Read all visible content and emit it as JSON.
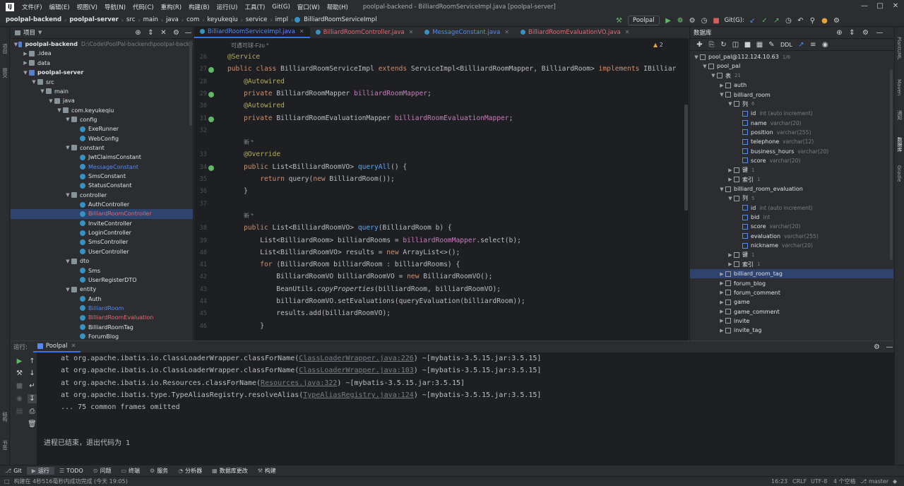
{
  "menubar": {
    "logo": "IJ",
    "items": [
      "文件(F)",
      "编辑(E)",
      "视图(V)",
      "导航(N)",
      "代码(C)",
      "重构(R)",
      "构建(B)",
      "运行(U)",
      "工具(T)",
      "Git(G)",
      "窗口(W)",
      "帮助(H)"
    ],
    "window_title": "poolpal-backend - BilliardRoomServiceImpl.java [poolpal-server]"
  },
  "navbar": {
    "breadcrumbs": [
      "poolpal-backend",
      "poolpal-server",
      "src",
      "main",
      "java",
      "com",
      "keyukeqiu",
      "service",
      "impl",
      "BilliardRoomServiceImpl"
    ],
    "run_config": "Poolpal",
    "git_label": "Git(G):"
  },
  "left_strip": {
    "labels": [
      "项目",
      "提交",
      "结构",
      "书签"
    ]
  },
  "right_strip": {
    "labels": [
      "PlantUML",
      "Maven",
      "通知",
      "数据库",
      "Gradle"
    ]
  },
  "project": {
    "title": "项目",
    "tree": [
      {
        "label": "poolpal-backend",
        "path": "D:\\Code\\PoolPal-backend\\poolpal-backe",
        "depth": 0,
        "open": true,
        "icon": "module",
        "bold": true
      },
      {
        "label": ".idea",
        "depth": 1,
        "open": false,
        "icon": "folder"
      },
      {
        "label": "data",
        "depth": 1,
        "open": false,
        "icon": "folder"
      },
      {
        "label": "poolpal-server",
        "depth": 1,
        "open": true,
        "icon": "module",
        "bold": true
      },
      {
        "label": "src",
        "depth": 2,
        "open": true,
        "icon": "folder"
      },
      {
        "label": "main",
        "depth": 3,
        "open": true,
        "icon": "folder"
      },
      {
        "label": "java",
        "depth": 4,
        "open": true,
        "icon": "folder"
      },
      {
        "label": "com.keyukeqiu",
        "depth": 5,
        "open": true,
        "icon": "folder"
      },
      {
        "label": "config",
        "depth": 6,
        "open": true,
        "icon": "folder"
      },
      {
        "label": "ExeRunner",
        "depth": 7,
        "icon": "class"
      },
      {
        "label": "WebConfig",
        "depth": 7,
        "icon": "class"
      },
      {
        "label": "constant",
        "depth": 6,
        "open": true,
        "icon": "folder"
      },
      {
        "label": "JwtClaimsConstant",
        "depth": 7,
        "icon": "class"
      },
      {
        "label": "MessageConstant",
        "depth": 7,
        "icon": "class",
        "color": "#548af7"
      },
      {
        "label": "SmsConstant",
        "depth": 7,
        "icon": "class"
      },
      {
        "label": "StatusConstant",
        "depth": 7,
        "icon": "class"
      },
      {
        "label": "controller",
        "depth": 6,
        "open": true,
        "icon": "folder"
      },
      {
        "label": "AuthController",
        "depth": 7,
        "icon": "class"
      },
      {
        "label": "BilliardRoomController",
        "depth": 7,
        "icon": "class",
        "color": "#e06c75",
        "selected": true
      },
      {
        "label": "InviteController",
        "depth": 7,
        "icon": "class"
      },
      {
        "label": "LoginController",
        "depth": 7,
        "icon": "class"
      },
      {
        "label": "SmsController",
        "depth": 7,
        "icon": "class"
      },
      {
        "label": "UserController",
        "depth": 7,
        "icon": "class"
      },
      {
        "label": "dto",
        "depth": 6,
        "open": true,
        "icon": "folder"
      },
      {
        "label": "Sms",
        "depth": 7,
        "icon": "class"
      },
      {
        "label": "UserRegisterDTO",
        "depth": 7,
        "icon": "class"
      },
      {
        "label": "entity",
        "depth": 6,
        "open": true,
        "icon": "folder"
      },
      {
        "label": "Auth",
        "depth": 7,
        "icon": "class"
      },
      {
        "label": "BilliardRoom",
        "depth": 7,
        "icon": "class",
        "color": "#548af7"
      },
      {
        "label": "BilliardRoomEvaluation",
        "depth": 7,
        "icon": "class",
        "color": "#e06c75"
      },
      {
        "label": "BilliardRoomTag",
        "depth": 7,
        "icon": "class"
      },
      {
        "label": "ForumBlog",
        "depth": 7,
        "icon": "class"
      }
    ]
  },
  "editor": {
    "tabs": [
      {
        "label": "BilliardRoomServiceImpl.java",
        "active": true,
        "color": "#548af7"
      },
      {
        "label": "BilliardRoomController.java",
        "color": "#e06c75"
      },
      {
        "label": "MessageConstant.java",
        "color": "#548af7"
      },
      {
        "label": "BilliardRoomEvaluationVO.java",
        "color": "#e06c75"
      }
    ],
    "author_hint": "可遇可球-Fzu *",
    "warnings": "2",
    "lines": [
      {
        "n": "26",
        "html": "<span class='an'>@Service</span>"
      },
      {
        "n": "27",
        "html": "<span class='kw'>public class</span> BilliardRoomServiceImpl <span class='kw'>extends</span> ServiceImpl&lt;BilliardRoomMapper, BilliardRoom&gt; <span class='kw'>implements</span> IBilliar"
      },
      {
        "n": "28",
        "html": "    <span class='an'>@Autowired</span>"
      },
      {
        "n": "29",
        "html": "    <span class='kw'>private</span> BilliardRoomMapper <span class='fld'>billiardRoomMapper</span>;"
      },
      {
        "n": "30",
        "html": "    <span class='an'>@Autowired</span>"
      },
      {
        "n": "31",
        "html": "    <span class='kw'>private</span> BilliardRoomEvaluationMapper <span class='fld'>billiardRoomEvaluationMapper</span>;"
      },
      {
        "n": "32",
        "html": ""
      },
      {
        "n": "",
        "html": "    <span class='hint'>新 *</span>"
      },
      {
        "n": "33",
        "html": "    <span class='an'>@Override</span>"
      },
      {
        "n": "34",
        "html": "    <span class='kw'>public</span> List&lt;BilliardRoomVO&gt; <span class='fn'>queryAll</span>() {"
      },
      {
        "n": "35",
        "html": "        <span class='kw'>return</span> query(<span class='kw'>new</span> BilliardRoom());"
      },
      {
        "n": "36",
        "html": "    }"
      },
      {
        "n": "37",
        "html": ""
      },
      {
        "n": "",
        "html": "    <span class='hint'>新 *</span>"
      },
      {
        "n": "38",
        "html": "    <span class='kw'>public</span> List&lt;BilliardRoomVO&gt; <span class='fn'>query</span>(BilliardRoom b) {"
      },
      {
        "n": "39",
        "html": "        List&lt;BilliardRoom&gt; billiardRooms = <span class='fld'>billiardRoomMapper</span>.select(b);"
      },
      {
        "n": "40",
        "html": "        List&lt;BilliardRoomVO&gt; results = <span class='kw'>new</span> ArrayList&lt;&gt;();"
      },
      {
        "n": "41",
        "html": "        <span class='kw'>for</span> (BilliardRoom billiardRoom : billiardRooms) {"
      },
      {
        "n": "42",
        "html": "            BilliardRoomVO billiardRoomVO = <span class='kw'>new</span> BilliardRoomVO();"
      },
      {
        "n": "43",
        "html": "            BeanUtils.<span class='it'>copyProperties</span>(billiardRoom, billiardRoomVO);"
      },
      {
        "n": "44",
        "html": "            billiardRoomVO.setEvaluations(queryEvaluation(billiardRoom));"
      },
      {
        "n": "45",
        "html": "            results.add(billiardRoomVO);"
      },
      {
        "n": "46",
        "html": "        }"
      }
    ]
  },
  "database": {
    "title": "数据库",
    "ddl_label": "DDL",
    "tree": [
      {
        "label": "pool_pal@112.124.10.63",
        "count": "1/6",
        "depth": 0,
        "open": true
      },
      {
        "label": "pool_pal",
        "depth": 1,
        "open": true
      },
      {
        "label": "表",
        "count": "21",
        "depth": 2,
        "open": true
      },
      {
        "label": "auth",
        "depth": 3,
        "open": false
      },
      {
        "label": "billiard_room",
        "depth": 3,
        "open": true
      },
      {
        "label": "列",
        "count": "6",
        "depth": 4,
        "open": true
      },
      {
        "label": "id",
        "type": "int (auto increment)",
        "depth": 5,
        "leaf": true
      },
      {
        "label": "name",
        "type": "varchar(20)",
        "depth": 5,
        "leaf": true
      },
      {
        "label": "position",
        "type": "varchar(255)",
        "depth": 5,
        "leaf": true
      },
      {
        "label": "telephone",
        "type": "varchar(12)",
        "depth": 5,
        "leaf": true
      },
      {
        "label": "business_hours",
        "type": "varchar(20)",
        "depth": 5,
        "leaf": true
      },
      {
        "label": "score",
        "type": "varchar(20)",
        "depth": 5,
        "leaf": true
      },
      {
        "label": "键",
        "count": "1",
        "depth": 4,
        "open": false
      },
      {
        "label": "索引",
        "count": "1",
        "depth": 4,
        "open": false
      },
      {
        "label": "billiard_room_evaluation",
        "depth": 3,
        "open": true
      },
      {
        "label": "列",
        "count": "5",
        "depth": 4,
        "open": true
      },
      {
        "label": "id",
        "type": "int (auto increment)",
        "depth": 5,
        "leaf": true
      },
      {
        "label": "bid",
        "type": "int",
        "depth": 5,
        "leaf": true
      },
      {
        "label": "score",
        "type": "varchar(20)",
        "depth": 5,
        "leaf": true
      },
      {
        "label": "evaluation",
        "type": "varchar(255)",
        "depth": 5,
        "leaf": true
      },
      {
        "label": "nickname",
        "type": "varchar(20)",
        "depth": 5,
        "leaf": true
      },
      {
        "label": "键",
        "count": "1",
        "depth": 4,
        "open": false
      },
      {
        "label": "索引",
        "count": "1",
        "depth": 4,
        "open": false
      },
      {
        "label": "billiard_room_tag",
        "depth": 3,
        "open": false,
        "selected": true
      },
      {
        "label": "forum_blog",
        "depth": 3,
        "open": false
      },
      {
        "label": "forum_comment",
        "depth": 3,
        "open": false
      },
      {
        "label": "game",
        "depth": 3,
        "open": false
      },
      {
        "label": "game_comment",
        "depth": 3,
        "open": false
      },
      {
        "label": "invite",
        "depth": 3,
        "open": false
      },
      {
        "label": "invite_tag",
        "depth": 3,
        "open": false
      }
    ]
  },
  "run": {
    "label": "运行:",
    "tab": "Poolpal",
    "lines": [
      {
        "pre": "    at org.apache.ibatis.io.ClassLoaderWrapper.classForName(",
        "link": "ClassLoaderWrapper.java:226",
        "post": ") ~[mybatis-3.5.15.jar:3.5.15]"
      },
      {
        "pre": "    at org.apache.ibatis.io.ClassLoaderWrapper.classForName(",
        "link": "ClassLoaderWrapper.java:103",
        "post": ") ~[mybatis-3.5.15.jar:3.5.15]"
      },
      {
        "pre": "    at org.apache.ibatis.io.Resources.classForName(",
        "link": "Resources.java:322",
        "post": ") ~[mybatis-3.5.15.jar:3.5.15]"
      },
      {
        "pre": "    at org.apache.ibatis.type.TypeAliasRegistry.resolveAlias(",
        "link": "TypeAliasRegistry.java:124",
        "post": ") ~[mybatis-3.5.15.jar:3.5.15]"
      },
      {
        "pre": "    ... 75 common frames omitted",
        "link": "",
        "post": ""
      }
    ],
    "exit_msg": "进程已结束，退出代码为 1"
  },
  "bottom_tabs": [
    "Git",
    "运行",
    "TODO",
    "问题",
    "终端",
    "服务",
    "分析器",
    "数据库更改",
    "构建"
  ],
  "status": {
    "message": "构建在 4秒516毫秒内成功完成 (今天 19:05)",
    "position": "16:23",
    "line_sep": "CRLF",
    "encoding": "UTF-8",
    "indent": "4 个空格",
    "branch": "master"
  }
}
